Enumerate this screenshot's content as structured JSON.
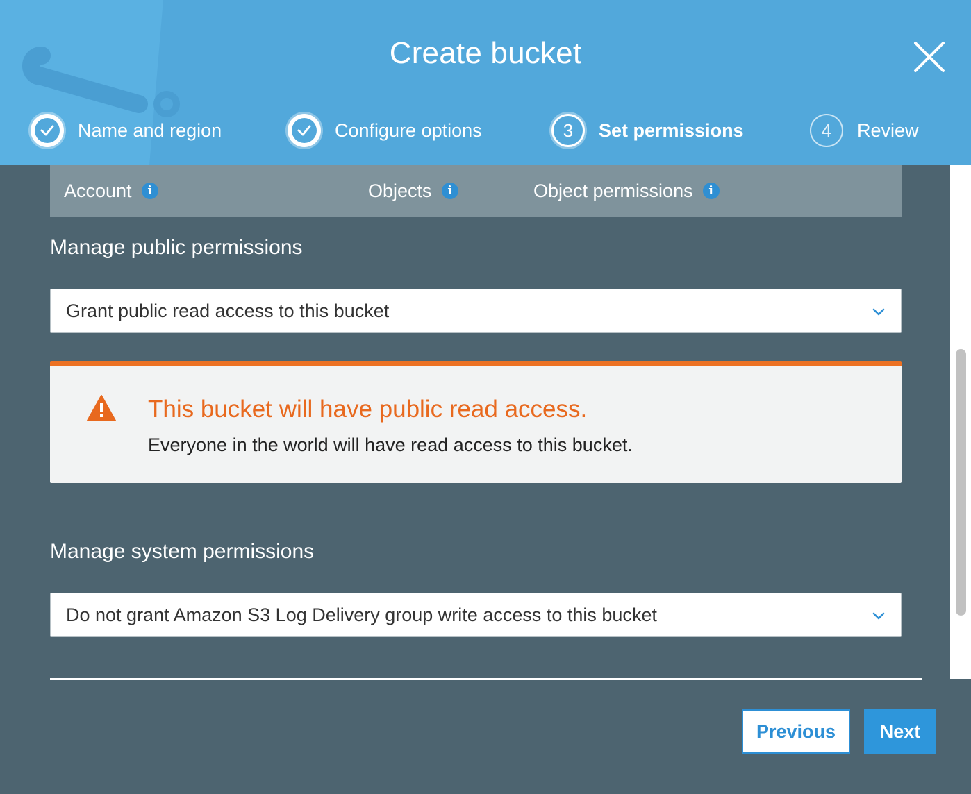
{
  "dialog": {
    "title": "Create bucket"
  },
  "steps": [
    {
      "label": "Name and region",
      "state": "done",
      "marker": ""
    },
    {
      "label": "Configure options",
      "state": "done",
      "marker": ""
    },
    {
      "label": "Set permissions",
      "state": "current",
      "marker": "3"
    },
    {
      "label": "Review",
      "state": "pending",
      "marker": "4"
    }
  ],
  "tabs": [
    {
      "label": "Account",
      "icon": "info-icon"
    },
    {
      "label": "Objects",
      "icon": "info-icon"
    },
    {
      "label": "Object permissions",
      "icon": "info-icon"
    }
  ],
  "public_permissions": {
    "label": "Manage public permissions",
    "selected": "Grant public read access to this bucket"
  },
  "alert": {
    "title": "This bucket will have public read access.",
    "body": "Everyone in the world will have read access to this bucket.",
    "icon": "warning-icon",
    "color": "#ec7123"
  },
  "system_permissions": {
    "label": "Manage system permissions",
    "selected": "Do not grant Amazon S3 Log Delivery group write access to this bucket"
  },
  "buttons": {
    "previous": "Previous",
    "next": "Next"
  },
  "colors": {
    "header": "#52a8db",
    "body": "#4d6470",
    "accent": "#2e96db"
  }
}
